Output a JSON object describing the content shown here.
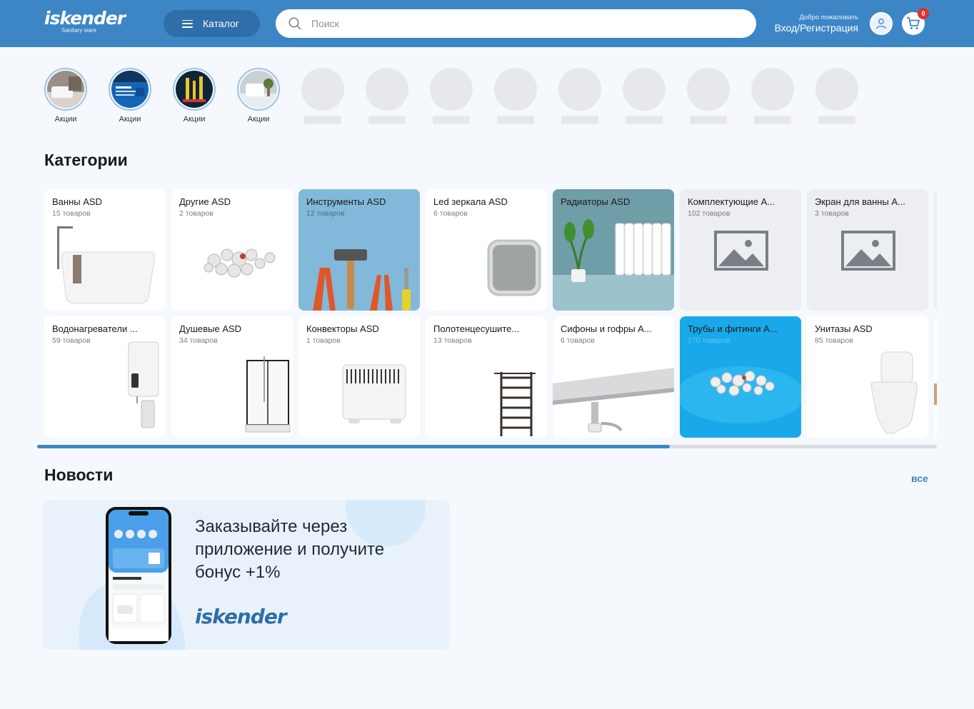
{
  "header": {
    "logo": "iskender",
    "logo_sub": "Sanitary ware",
    "catalog_label": "Каталог",
    "search_placeholder": "Поиск",
    "welcome": "Добро пожаловать",
    "login_label": "Вход/Регистрация",
    "cart_count": "0"
  },
  "stories": [
    {
      "label": "Акции"
    },
    {
      "label": "Акции"
    },
    {
      "label": "Акции"
    },
    {
      "label": "Акции"
    }
  ],
  "categories_title": "Категории",
  "categories": [
    {
      "name": "Ванны ASD",
      "count": "15 товаров"
    },
    {
      "name": "Другие ASD",
      "count": "2 товаров"
    },
    {
      "name": "Инструменты ASD",
      "count": "12 товаров"
    },
    {
      "name": "Led зеркала ASD",
      "count": "6 товаров"
    },
    {
      "name": "Радиаторы ASD",
      "count": ""
    },
    {
      "name": "Комплектующие A...",
      "count": "102 товаров"
    },
    {
      "name": "Экран для ванны A...",
      "count": "3 товаров"
    },
    {
      "name": "Водонагреватели ...",
      "count": "59 товаров"
    },
    {
      "name": "Душевые ASD",
      "count": "34 товаров"
    },
    {
      "name": "Конвекторы ASD",
      "count": "1 товаров"
    },
    {
      "name": "Полотенцесушите...",
      "count": "13 товаров"
    },
    {
      "name": "Сифоны и гофры A...",
      "count": "6 товаров"
    },
    {
      "name": "Трубы и фитинги A...",
      "count": "170 товаров"
    },
    {
      "name": "Унитазы ASD",
      "count": "85 товаров"
    }
  ],
  "news_title": "Новости",
  "news_all": "все",
  "news": {
    "text": "Заказывайте через приложение и получите бонус +1%",
    "logo": "iskender"
  }
}
